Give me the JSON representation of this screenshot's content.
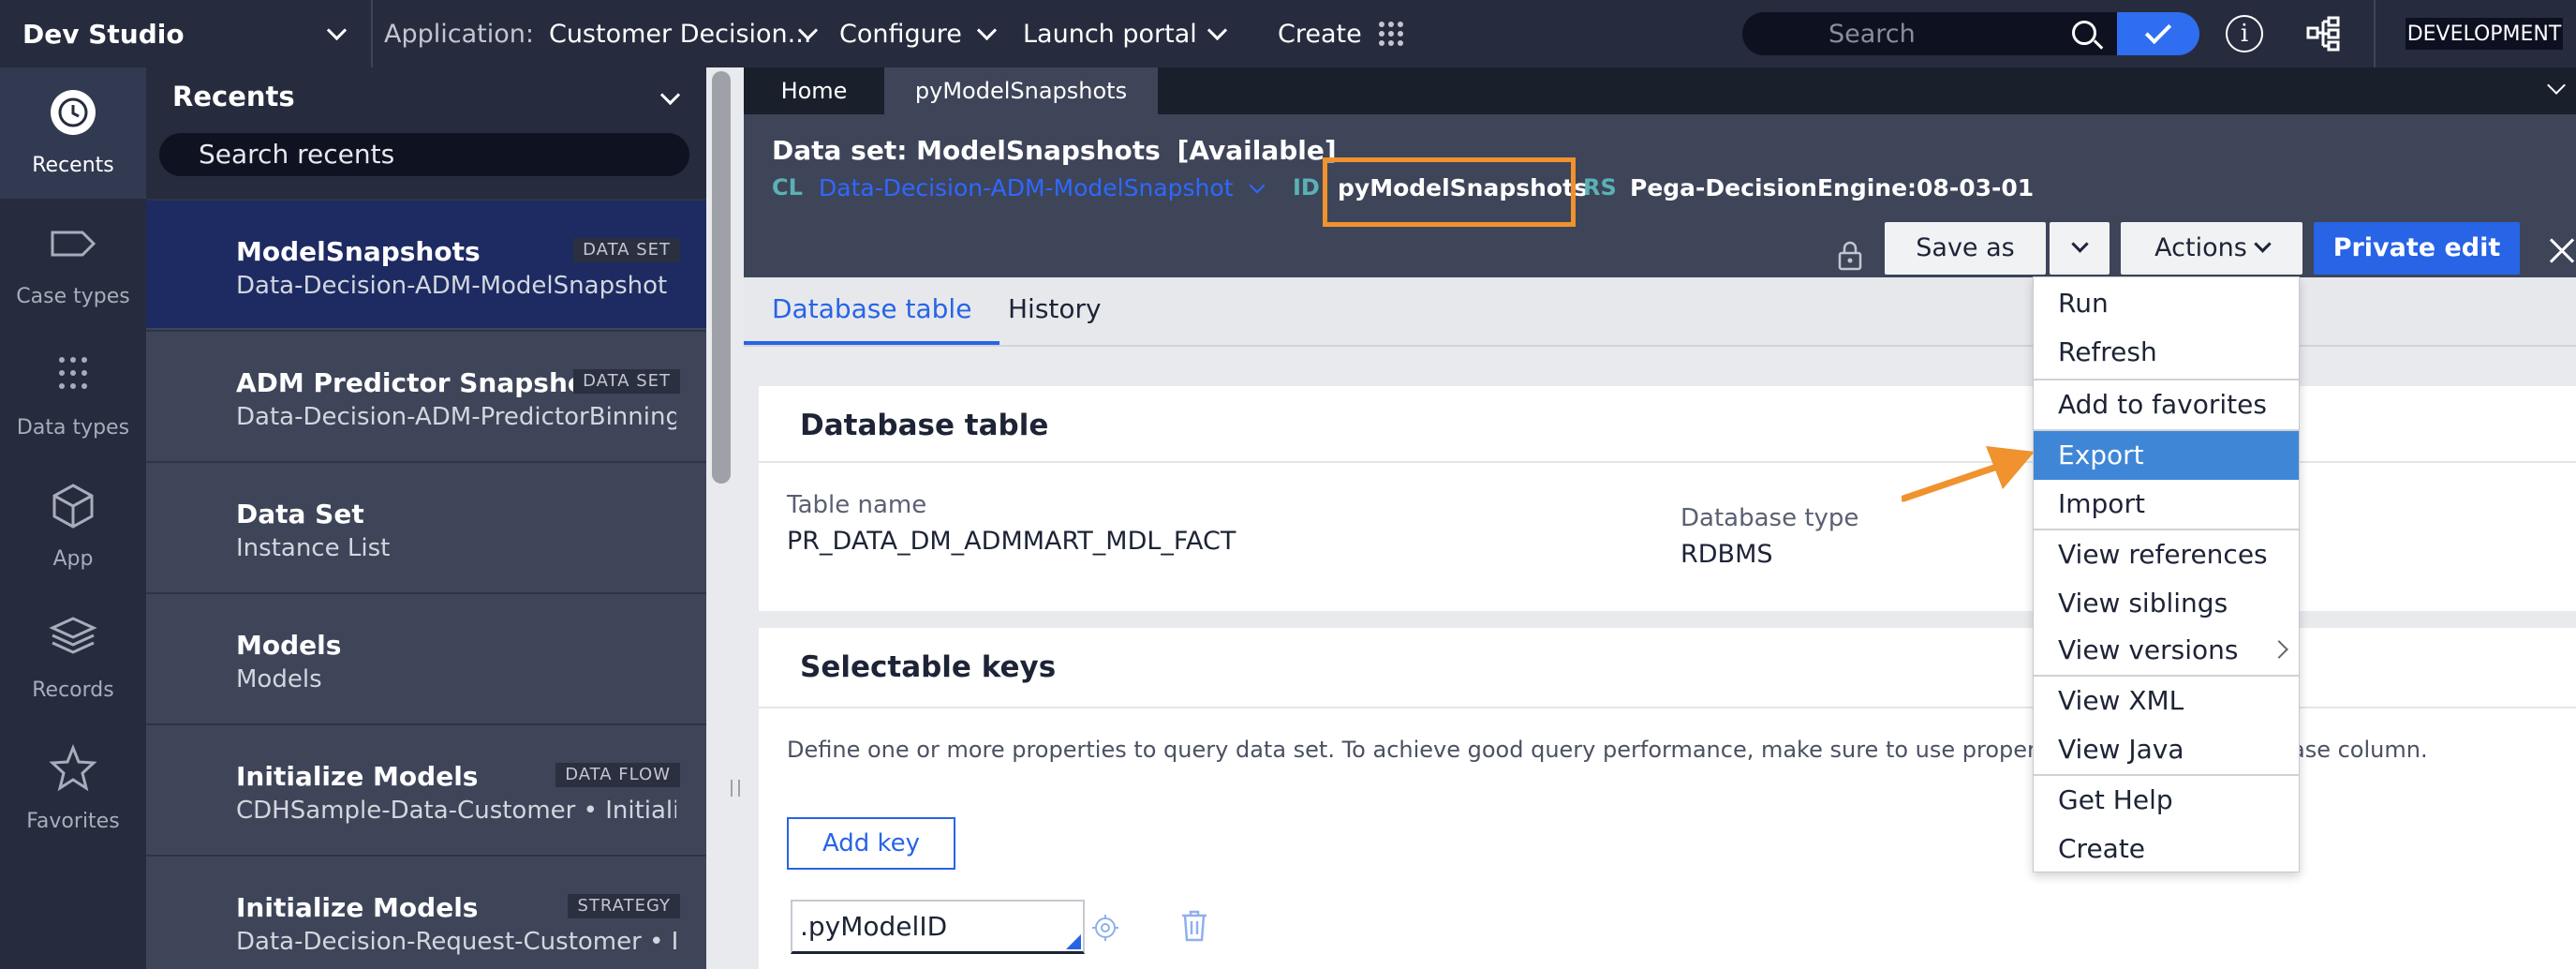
{
  "topbar": {
    "studio": "Dev Studio",
    "application_label": "Application:",
    "application_value": "Customer Decision...",
    "configure": "Configure",
    "launch_portal": "Launch portal",
    "create": "Create",
    "search_placeholder": "Search",
    "environment": "DEVELOPMENT"
  },
  "leftnav": {
    "items": [
      {
        "label": "Recents",
        "icon": "clock-history-icon"
      },
      {
        "label": "Case types",
        "icon": "case-tag-icon"
      },
      {
        "label": "Data types",
        "icon": "dots-grid-icon"
      },
      {
        "label": "App",
        "icon": "cube-icon"
      },
      {
        "label": "Records",
        "icon": "layers-icon"
      },
      {
        "label": "Favorites",
        "icon": "star-icon"
      }
    ]
  },
  "recents": {
    "title": "Recents",
    "search_placeholder": "Search recents",
    "items": [
      {
        "title": "ModelSnapshots",
        "subtitle": "Data-Decision-ADM-ModelSnapshot •...",
        "badge": "DATA SET"
      },
      {
        "title": "ADM Predictor Snapshots",
        "subtitle": "Data-Decision-ADM-PredictorBinning...",
        "badge": "DATA SET"
      },
      {
        "title": "Data Set",
        "subtitle": "Instance List",
        "badge": ""
      },
      {
        "title": "Models",
        "subtitle": "Models",
        "badge": ""
      },
      {
        "title": "Initialize Models",
        "subtitle": "CDHSample-Data-Customer • Initializ...",
        "badge": "DATA FLOW"
      },
      {
        "title": "Initialize Models",
        "subtitle": "Data-Decision-Request-Customer • In...",
        "badge": "STRATEGY"
      }
    ]
  },
  "tabs": {
    "home": "Home",
    "active": "pyModelSnapshots"
  },
  "header": {
    "title": "Data set: ModelSnapshots",
    "status": "[Available]",
    "cl_label": "CL",
    "cl_value": "Data-Decision-ADM-ModelSnapshot",
    "id_label": "ID",
    "id_value": "pyModelSnapshots",
    "rs_label": "RS",
    "rs_value": "Pega-DecisionEngine:08-03-01",
    "save_as": "Save as",
    "actions": "Actions",
    "private_edit": "Private edit"
  },
  "subtabs": {
    "database_table": "Database table",
    "history": "History"
  },
  "db_card": {
    "title": "Database table",
    "table_name_label": "Table name",
    "table_name_value": "PR_DATA_DM_ADMMART_MDL_FACT",
    "db_type_label": "Database type",
    "db_type_value": "RDBMS"
  },
  "keys_card": {
    "title": "Selectable keys",
    "description": "Define one or more properties to query data set. To achieve good query performance, make sure to use properties map",
    "description_tail": "ase column.",
    "add_key": "Add key",
    "key_value": ".pyModelID"
  },
  "menu": {
    "items": [
      "Run",
      "Refresh",
      "Add to favorites",
      "Export",
      "Import",
      "View references",
      "View siblings",
      "View versions",
      "View XML",
      "View Java",
      "Get Help",
      "Create"
    ],
    "highlighted": "Export"
  },
  "colors": {
    "accent": "#2764e6",
    "highlight": "#f0922d",
    "menu_highlight": "#3f86d7"
  }
}
